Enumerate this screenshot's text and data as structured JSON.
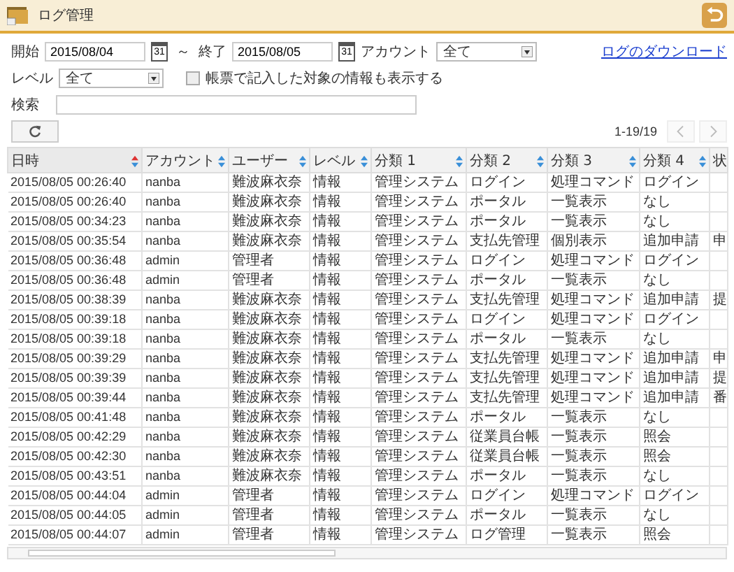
{
  "header": {
    "title": "ログ管理"
  },
  "filters": {
    "start_label": "開始",
    "start_value": "2015/08/04",
    "calendar_day": "31",
    "range_sep": "～",
    "end_label": "終了",
    "end_value": "2015/08/05",
    "end_calendar_day": "31",
    "account_label": "アカウント",
    "account_value": "全て",
    "download_link": "ログのダウンロード",
    "level_label": "レベル",
    "level_value": "全て",
    "include_forms": {
      "label": "帳票で記入した対象の情報も表示する",
      "checked": false
    },
    "search_label": "検索"
  },
  "pager": {
    "range": "1-19/19",
    "prev_disabled": true,
    "next_disabled": true
  },
  "table": {
    "columns": [
      {
        "label": "日時",
        "sortable": true,
        "sorted": true
      },
      {
        "label": "アカウント",
        "sortable": true,
        "sorted": false
      },
      {
        "label": "ユーザー",
        "sortable": true,
        "sorted": false
      },
      {
        "label": "レベル",
        "sortable": true,
        "sorted": false
      },
      {
        "label": "分類 1",
        "sortable": true,
        "sorted": false
      },
      {
        "label": "分類 2",
        "sortable": true,
        "sorted": false
      },
      {
        "label": "分類 3",
        "sortable": true,
        "sorted": false
      },
      {
        "label": "分類 4",
        "sortable": true,
        "sorted": false
      },
      {
        "label": "状",
        "sortable": false
      }
    ],
    "rows": [
      [
        "2015/08/05 00:26:40",
        "nanba",
        "難波麻衣奈",
        "情報",
        "管理システム",
        "ログイン",
        "処理コマンド",
        "ログイン"
      ],
      [
        "2015/08/05 00:26:40",
        "nanba",
        "難波麻衣奈",
        "情報",
        "管理システム",
        "ポータル",
        "一覧表示",
        "なし"
      ],
      [
        "2015/08/05 00:34:23",
        "nanba",
        "難波麻衣奈",
        "情報",
        "管理システム",
        "ポータル",
        "一覧表示",
        "なし"
      ],
      [
        "2015/08/05 00:35:54",
        "nanba",
        "難波麻衣奈",
        "情報",
        "管理システム",
        "支払先管理",
        "個別表示",
        "追加申請",
        "申"
      ],
      [
        "2015/08/05 00:36:48",
        "admin",
        "管理者",
        "情報",
        "管理システム",
        "ログイン",
        "処理コマンド",
        "ログイン"
      ],
      [
        "2015/08/05 00:36:48",
        "admin",
        "管理者",
        "情報",
        "管理システム",
        "ポータル",
        "一覧表示",
        "なし"
      ],
      [
        "2015/08/05 00:38:39",
        "nanba",
        "難波麻衣奈",
        "情報",
        "管理システム",
        "支払先管理",
        "処理コマンド",
        "追加申請",
        "提"
      ],
      [
        "2015/08/05 00:39:18",
        "nanba",
        "難波麻衣奈",
        "情報",
        "管理システム",
        "ログイン",
        "処理コマンド",
        "ログイン"
      ],
      [
        "2015/08/05 00:39:18",
        "nanba",
        "難波麻衣奈",
        "情報",
        "管理システム",
        "ポータル",
        "一覧表示",
        "なし"
      ],
      [
        "2015/08/05 00:39:29",
        "nanba",
        "難波麻衣奈",
        "情報",
        "管理システム",
        "支払先管理",
        "処理コマンド",
        "追加申請",
        "申"
      ],
      [
        "2015/08/05 00:39:39",
        "nanba",
        "難波麻衣奈",
        "情報",
        "管理システム",
        "支払先管理",
        "処理コマンド",
        "追加申請",
        "提"
      ],
      [
        "2015/08/05 00:39:44",
        "nanba",
        "難波麻衣奈",
        "情報",
        "管理システム",
        "支払先管理",
        "処理コマンド",
        "追加申請",
        "番"
      ],
      [
        "2015/08/05 00:41:48",
        "nanba",
        "難波麻衣奈",
        "情報",
        "管理システム",
        "ポータル",
        "一覧表示",
        "なし"
      ],
      [
        "2015/08/05 00:42:29",
        "nanba",
        "難波麻衣奈",
        "情報",
        "管理システム",
        "従業員台帳",
        "一覧表示",
        "照会"
      ],
      [
        "2015/08/05 00:42:30",
        "nanba",
        "難波麻衣奈",
        "情報",
        "管理システム",
        "従業員台帳",
        "一覧表示",
        "照会"
      ],
      [
        "2015/08/05 00:43:51",
        "nanba",
        "難波麻衣奈",
        "情報",
        "管理システム",
        "ポータル",
        "一覧表示",
        "なし"
      ],
      [
        "2015/08/05 00:44:04",
        "admin",
        "管理者",
        "情報",
        "管理システム",
        "ログイン",
        "処理コマンド",
        "ログイン"
      ],
      [
        "2015/08/05 00:44:05",
        "admin",
        "管理者",
        "情報",
        "管理システム",
        "ポータル",
        "一覧表示",
        "なし"
      ],
      [
        "2015/08/05 00:44:07",
        "admin",
        "管理者",
        "情報",
        "管理システム",
        "ログ管理",
        "一覧表示",
        "照会"
      ]
    ]
  }
}
